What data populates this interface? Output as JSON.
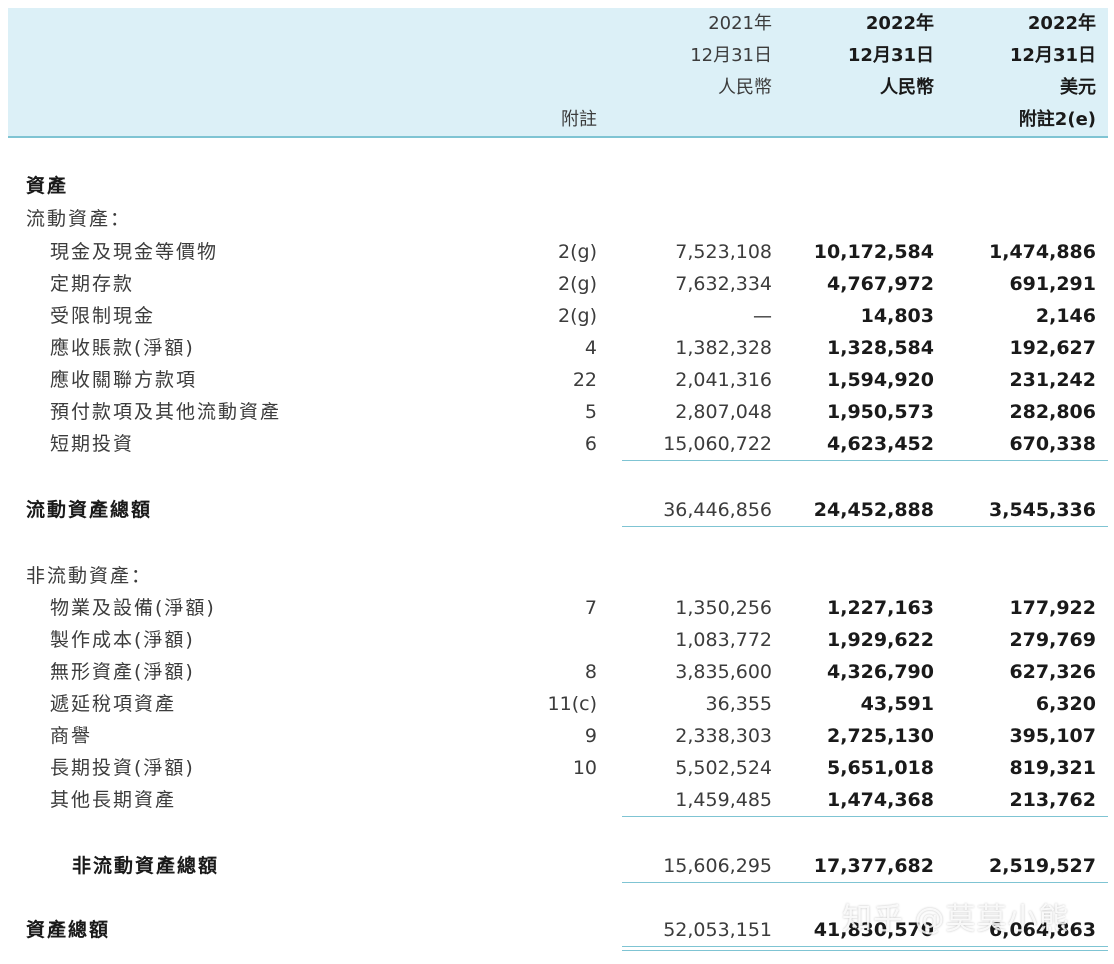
{
  "header": {
    "col_note": "附註",
    "col1": [
      "2021年",
      "12月31日",
      "人民幣"
    ],
    "col2": [
      "2022年",
      "12月31日",
      "人民幣"
    ],
    "col3": [
      "2022年",
      "12月31日",
      "美元",
      "附註2(e)"
    ]
  },
  "sections": {
    "assets": "資產",
    "current_assets": "流動資產：",
    "current_total": "流動資產總額",
    "noncurrent_assets": "非流動資產：",
    "noncurrent_total": "非流動資產總額",
    "total_assets": "資產總額"
  },
  "current_rows": [
    {
      "label": "現金及現金等價物",
      "note": "2(g)",
      "v2021": "7,523,108",
      "v2022": "10,172,584",
      "usd": "1,474,886"
    },
    {
      "label": "定期存款",
      "note": "2(g)",
      "v2021": "7,632,334",
      "v2022": "4,767,972",
      "usd": "691,291"
    },
    {
      "label": "受限制現金",
      "note": "2(g)",
      "v2021": "—",
      "v2022": "14,803",
      "usd": "2,146"
    },
    {
      "label": "應收賬款(淨額)",
      "note": "4",
      "v2021": "1,382,328",
      "v2022": "1,328,584",
      "usd": "192,627"
    },
    {
      "label": "應收關聯方款項",
      "note": "22",
      "v2021": "2,041,316",
      "v2022": "1,594,920",
      "usd": "231,242"
    },
    {
      "label": "預付款項及其他流動資產",
      "note": "5",
      "v2021": "2,807,048",
      "v2022": "1,950,573",
      "usd": "282,806"
    },
    {
      "label": "短期投資",
      "note": "6",
      "v2021": "15,060,722",
      "v2022": "4,623,452",
      "usd": "670,338"
    }
  ],
  "current_total_values": {
    "v2021": "36,446,856",
    "v2022": "24,452,888",
    "usd": "3,545,336"
  },
  "noncurrent_rows": [
    {
      "label": "物業及設備(淨額)",
      "note": "7",
      "v2021": "1,350,256",
      "v2022": "1,227,163",
      "usd": "177,922"
    },
    {
      "label": "製作成本(淨額)",
      "note": "",
      "v2021": "1,083,772",
      "v2022": "1,929,622",
      "usd": "279,769"
    },
    {
      "label": "無形資產(淨額)",
      "note": "8",
      "v2021": "3,835,600",
      "v2022": "4,326,790",
      "usd": "627,326"
    },
    {
      "label": "遞延稅項資產",
      "note": "11(c)",
      "v2021": "36,355",
      "v2022": "43,591",
      "usd": "6,320"
    },
    {
      "label": "商譽",
      "note": "9",
      "v2021": "2,338,303",
      "v2022": "2,725,130",
      "usd": "395,107"
    },
    {
      "label": "長期投資(淨額)",
      "note": "10",
      "v2021": "5,502,524",
      "v2022": "5,651,018",
      "usd": "819,321"
    },
    {
      "label": "其他長期資產",
      "note": "",
      "v2021": "1,459,485",
      "v2022": "1,474,368",
      "usd": "213,762"
    }
  ],
  "noncurrent_total_values": {
    "v2021": "15,606,295",
    "v2022": "17,377,682",
    "usd": "2,519,527"
  },
  "total_assets_values": {
    "v2021": "52,053,151",
    "v2022": "41,830,570",
    "usd": "6,064,863"
  },
  "watermark": "知乎 @莫莫小熊"
}
